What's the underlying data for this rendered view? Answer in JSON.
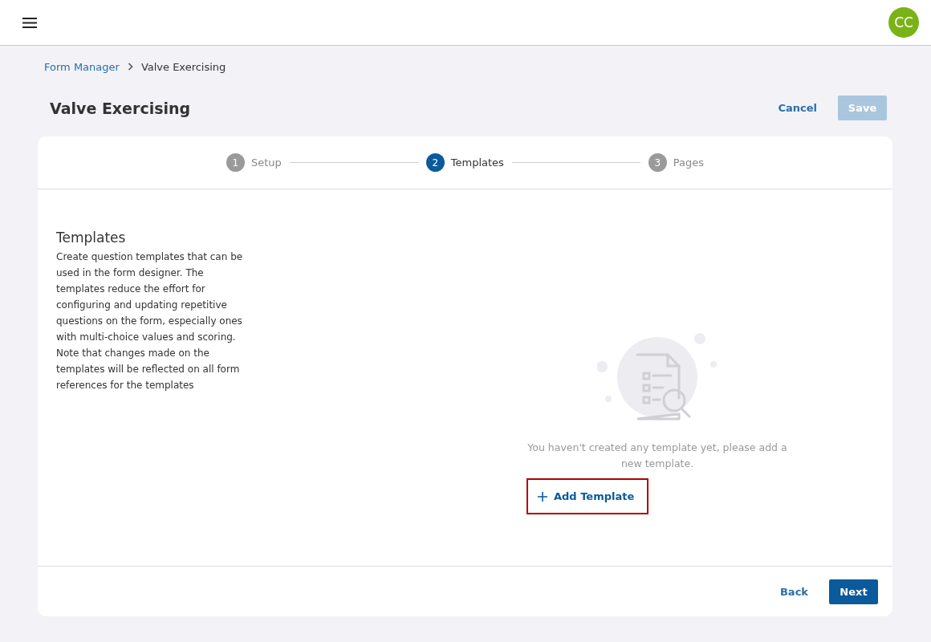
{
  "header": {
    "avatar": "CC"
  },
  "breadcrumb": [
    {
      "label": "Form Manager",
      "kind": "link"
    },
    {
      "label": "Valve Exercising",
      "kind": "current"
    }
  ],
  "page": {
    "title": "Valve Exercising",
    "cancel": "Cancel",
    "save": {
      "label": "Save",
      "disabled": true
    }
  },
  "steps": [
    {
      "number": "1",
      "label": "Setup",
      "selected": false
    },
    {
      "number": "2",
      "label": "Templates",
      "selected": true
    },
    {
      "number": "3",
      "label": "Pages",
      "selected": false
    }
  ],
  "section": {
    "title": "Templates",
    "description": "Create question templates that can be used in the form designer. The templates reduce the effort for configuring and updating repetitive questions on the form, especially ones with multi-choice values and scoring. Note that changes made on the templates will be reflected on all form references for the templates"
  },
  "empty_state": {
    "message": "You haven't created any template yet, please add a new template.",
    "add_button": {
      "label": "Add Template",
      "highlighted": true
    }
  },
  "footer": {
    "back": "Back",
    "next": "Next"
  }
}
